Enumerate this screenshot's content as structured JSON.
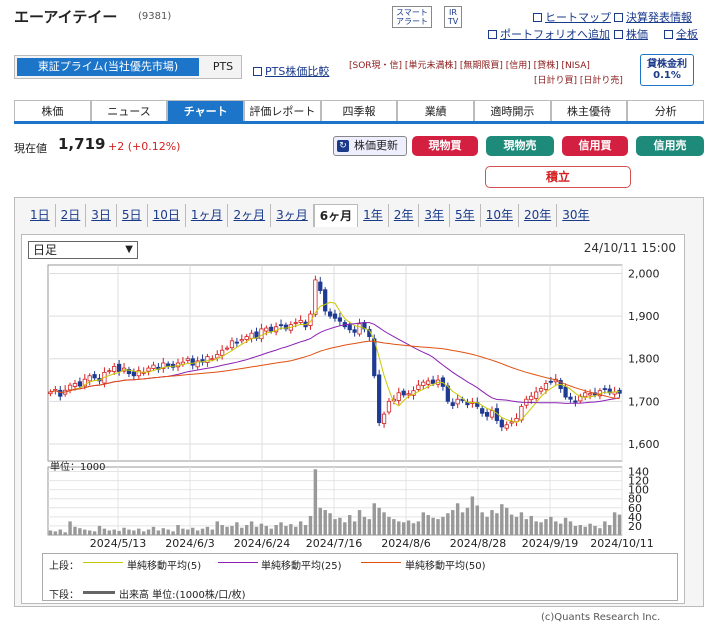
{
  "header": {
    "title": "エーアイテイー",
    "code": "(9381)",
    "smart_alert": [
      "スマート",
      "アラート"
    ],
    "ir_tv": [
      "IR",
      "TV"
    ],
    "links": [
      "ヒートマップ",
      "決算発表情報",
      "ポートフォリオへ追加",
      "株価",
      "全板"
    ]
  },
  "market": {
    "primary": "東証プライム(当社優先市場)",
    "pts": "PTS",
    "pts_compare": "PTS株価比較"
  },
  "tags": {
    "row1": "[SOR現・信] [単元未満株] [無期限買] [信用] [貸株] [NISA]",
    "row2": "[日計り買] [日計り売]",
    "lending": [
      "貸株金利",
      "0.1%"
    ]
  },
  "tabs": [
    "株価",
    "ニュース",
    "チャート",
    "評価レポート",
    "四季報",
    "業績",
    "適時開示",
    "株主優待",
    "分析"
  ],
  "active_tab": 2,
  "price": {
    "label": "現在値",
    "value": "1,719",
    "change": "+2 (+0.12%)",
    "refresh": "株価更新"
  },
  "trade_buttons": [
    "現物買",
    "現物売",
    "信用買",
    "信用売"
  ],
  "tsumitate": "積立",
  "ranges": [
    "1日",
    "2日",
    "3日",
    "5日",
    "10日",
    "1ヶ月",
    "2ヶ月",
    "3ヶ月",
    "6ヶ月",
    "1年",
    "2年",
    "3年",
    "5年",
    "10年",
    "20年",
    "30年"
  ],
  "active_range": 8,
  "period_select": "日足",
  "timestamp": "24/10/11 15:00",
  "legend": {
    "upper_label": "上段：",
    "lower_label": "下段：",
    "ma5": "単純移動平均(5)",
    "ma25": "単純移動平均(25)",
    "ma50": "単純移動平均(50)",
    "volume": "出来高 単位:(1000株/口/枚)"
  },
  "credit": "(c)Quants Research Inc.",
  "colors": {
    "up": "#d42020",
    "down": "#1f3a93",
    "accent": "#1c75c8",
    "ma5": "#c8c800",
    "ma25": "#8c20b4",
    "ma50": "#e05010"
  },
  "chart_data": {
    "type": "candlestick",
    "price_ylim": [
      1560,
      2020
    ],
    "price_ticks": [
      "2,000",
      "1,900",
      "1,800",
      "1,700",
      "1,600"
    ],
    "volume_ylim": [
      0,
      150
    ],
    "volume_ticks": [
      "140",
      "120",
      "100",
      "80",
      "60",
      "40",
      "20"
    ],
    "volume_unit": "単位：1000",
    "x_labels": [
      "2024/5/13",
      "2024/6/3",
      "2024/6/24",
      "2024/7/16",
      "2024/8/6",
      "2024/8/28",
      "2024/9/19",
      "2024/10/11"
    ],
    "closes": [
      1722,
      1728,
      1712,
      1726,
      1738,
      1742,
      1736,
      1752,
      1760,
      1755,
      1748,
      1768,
      1772,
      1782,
      1770,
      1778,
      1765,
      1760,
      1772,
      1768,
      1778,
      1785,
      1775,
      1790,
      1782,
      1780,
      1790,
      1792,
      1800,
      1785,
      1795,
      1792,
      1805,
      1800,
      1810,
      1820,
      1825,
      1842,
      1838,
      1845,
      1852,
      1860,
      1848,
      1870,
      1872,
      1865,
      1875,
      1878,
      1870,
      1880,
      1885,
      1890,
      1875,
      1905,
      1985,
      1960,
      1912,
      1900,
      1895,
      1888,
      1875,
      1868,
      1862,
      1882,
      1870,
      1852,
      1760,
      1650,
      1670,
      1700,
      1705,
      1720,
      1715,
      1718,
      1725,
      1738,
      1745,
      1748,
      1742,
      1750,
      1735,
      1700,
      1690,
      1705,
      1702,
      1692,
      1698,
      1688,
      1672,
      1665,
      1678,
      1655,
      1640,
      1645,
      1652,
      1660,
      1688,
      1705,
      1712,
      1722,
      1730,
      1742,
      1745,
      1752,
      1730,
      1710,
      1705,
      1698,
      1712,
      1720,
      1718,
      1715,
      1725,
      1728,
      1720,
      1722,
      1719
    ],
    "volumes": [
      10,
      8,
      12,
      6,
      30,
      18,
      15,
      12,
      10,
      8,
      20,
      14,
      10,
      12,
      9,
      16,
      12,
      10,
      14,
      8,
      12,
      18,
      10,
      15,
      12,
      8,
      22,
      14,
      12,
      16,
      10,
      14,
      18,
      12,
      30,
      22,
      18,
      20,
      28,
      16,
      22,
      30,
      18,
      25,
      20,
      14,
      22,
      28,
      20,
      24,
      18,
      30,
      22,
      42,
      145,
      60,
      55,
      48,
      35,
      38,
      28,
      44,
      30,
      55,
      40,
      35,
      70,
      60,
      50,
      40,
      35,
      30,
      28,
      32,
      26,
      30,
      50,
      44,
      38,
      35,
      40,
      48,
      55,
      70,
      50,
      60,
      85,
      65,
      50,
      40,
      55,
      48,
      68,
      60,
      45,
      40,
      50,
      35,
      42,
      30,
      28,
      35,
      40,
      30,
      25,
      38,
      30,
      20,
      22,
      18,
      25,
      20,
      15,
      30,
      22,
      50,
      45
    ]
  }
}
